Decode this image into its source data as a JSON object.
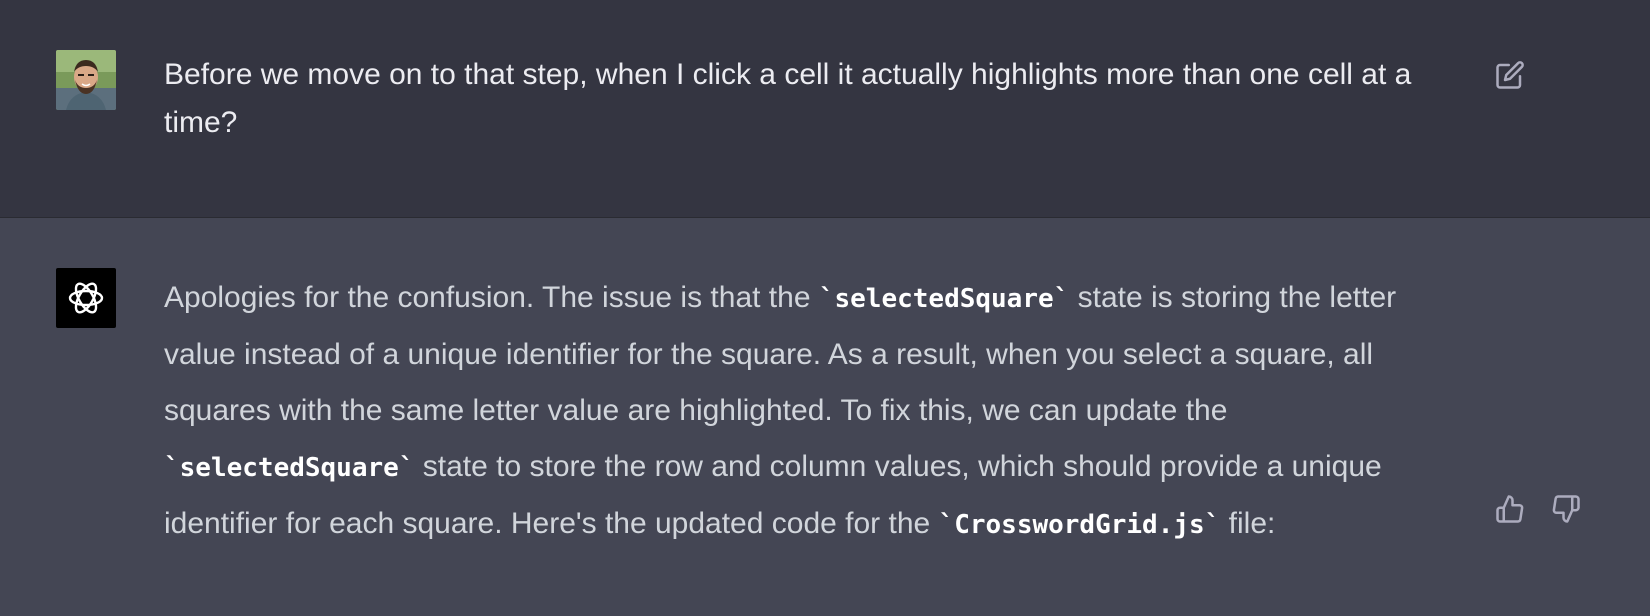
{
  "user_message": {
    "text": "Before we move on to that step, when I click a cell it actually highlights more than one cell at a time?"
  },
  "assistant_message": {
    "parts": [
      "Apologies for the confusion. The issue is that the ",
      "`selectedSquare`",
      " state is storing the letter value instead of a unique identifier for the square. As a result, when you select a square, all squares with the same letter value are highlighted. To fix this, we can update the ",
      "`selectedSquare`",
      " state to store the row and column values, which should provide a unique identifier for each square. Here's the updated code for the ",
      "`CrosswordGrid.js`",
      " file:"
    ]
  },
  "icons": {
    "user_avatar": "user-avatar-photo",
    "bot_avatar": "openai-logo-icon",
    "edit": "edit-icon",
    "thumbs_up": "thumbs-up-icon",
    "thumbs_down": "thumbs-down-icon"
  },
  "colors": {
    "user_bg": "#343541",
    "assistant_bg": "#444654",
    "user_text": "#ececf1",
    "assistant_text": "#d1d5db",
    "icon": "#acacbe"
  }
}
